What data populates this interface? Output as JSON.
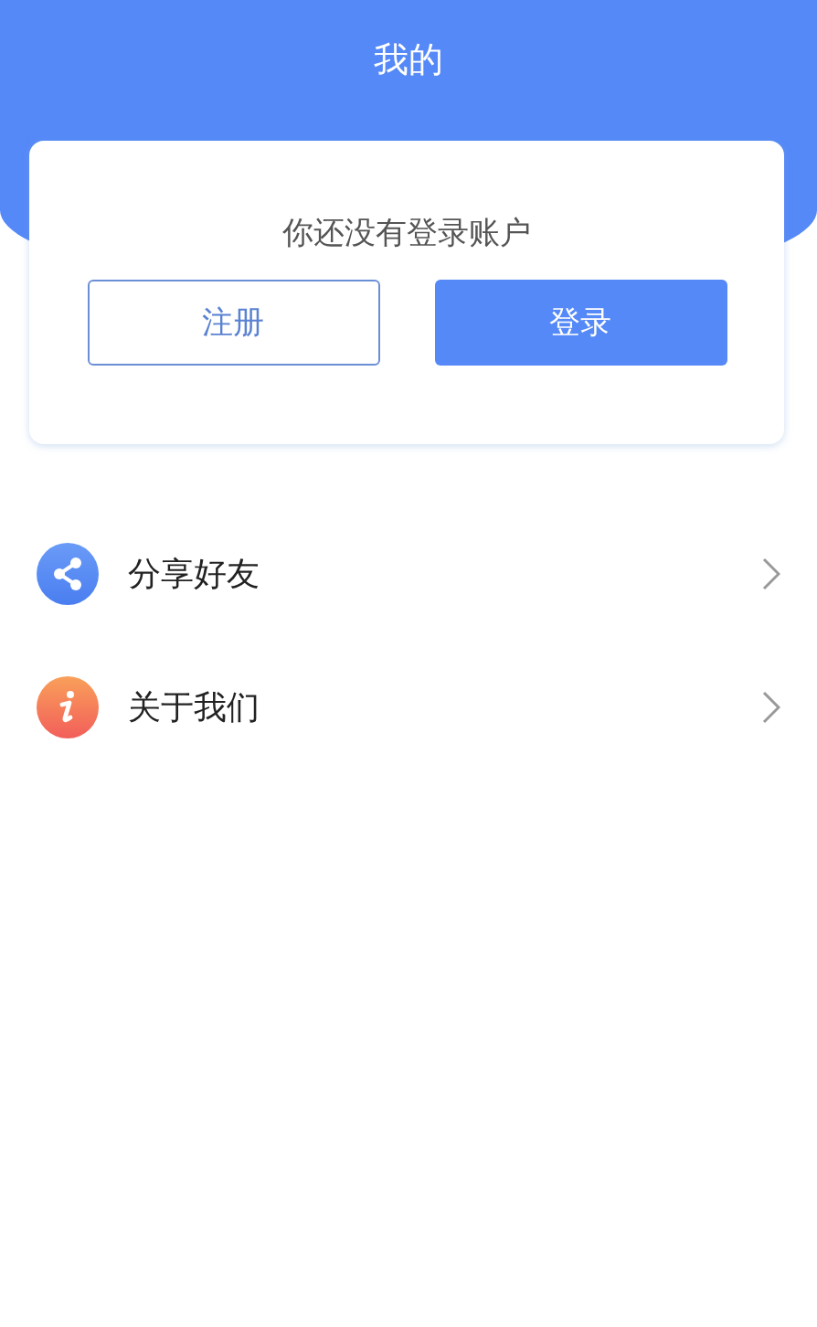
{
  "header": {
    "title": "我的"
  },
  "login_card": {
    "message": "你还没有登录账户",
    "buttons": [
      {
        "label": "注册",
        "kind": "outline"
      },
      {
        "label": "登录",
        "kind": "primary"
      }
    ]
  },
  "menu": [
    {
      "label": "分享好友",
      "kind": "share"
    },
    {
      "label": "关于我们",
      "kind": "info"
    }
  ]
}
